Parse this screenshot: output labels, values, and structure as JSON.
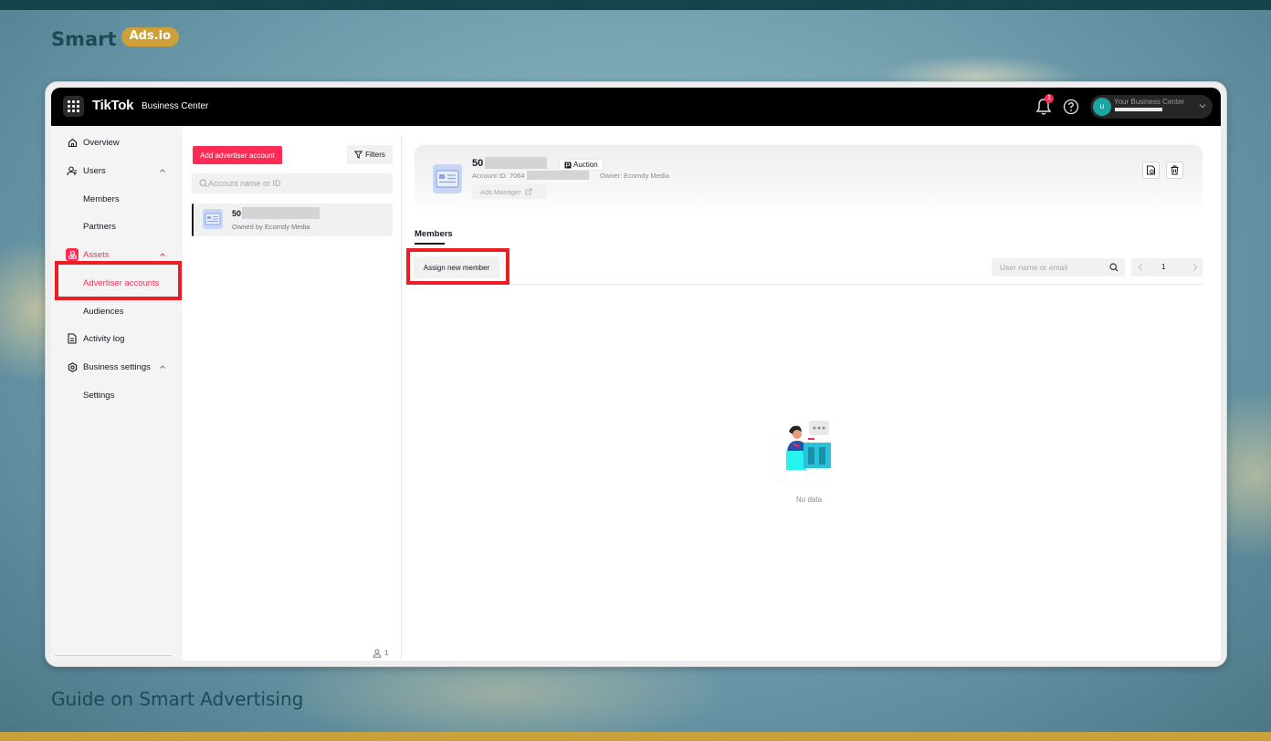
{
  "brand": {
    "word": "Smart",
    "pill": "Ads.io"
  },
  "caption": "Guide on Smart Advertising",
  "colors": {
    "accent": "#fe2c55",
    "highlight": "#ee1d23",
    "topbar": "#000000",
    "brand_gold": "#d0a038",
    "brand_teal": "#1d4a55"
  },
  "topbar": {
    "logo": "TikTok",
    "subtitle": "Business Center",
    "notification_count": "1",
    "account_label": "Your Business Center",
    "account_initial": "u"
  },
  "sidebar": {
    "overview": "Overview",
    "users": "Users",
    "members": "Members",
    "partners": "Partners",
    "assets": "Assets",
    "advertiser_accounts": "Advertiser accounts",
    "audiences": "Audiences",
    "activity_log": "Activity log",
    "business_settings": "Business settings",
    "settings": "Settings"
  },
  "list_panel": {
    "add_button": "Add advertiser account",
    "filters_button": "Filters",
    "search_placeholder": "Account name or ID",
    "account_card": {
      "name": "50",
      "owner": "Owned by Ecomdy Media"
    },
    "member_count": "1"
  },
  "detail": {
    "account_name": "50",
    "auction_tag": "Auction",
    "account_id": "Account ID: 7064",
    "owner": "Owner: Ecomdy Media",
    "ads_manager": "Ads Manager",
    "tab_members": "Members",
    "assign_button": "Assign new member",
    "user_search_placeholder": "User name or email",
    "page_number": "1",
    "empty_text": "No data"
  }
}
